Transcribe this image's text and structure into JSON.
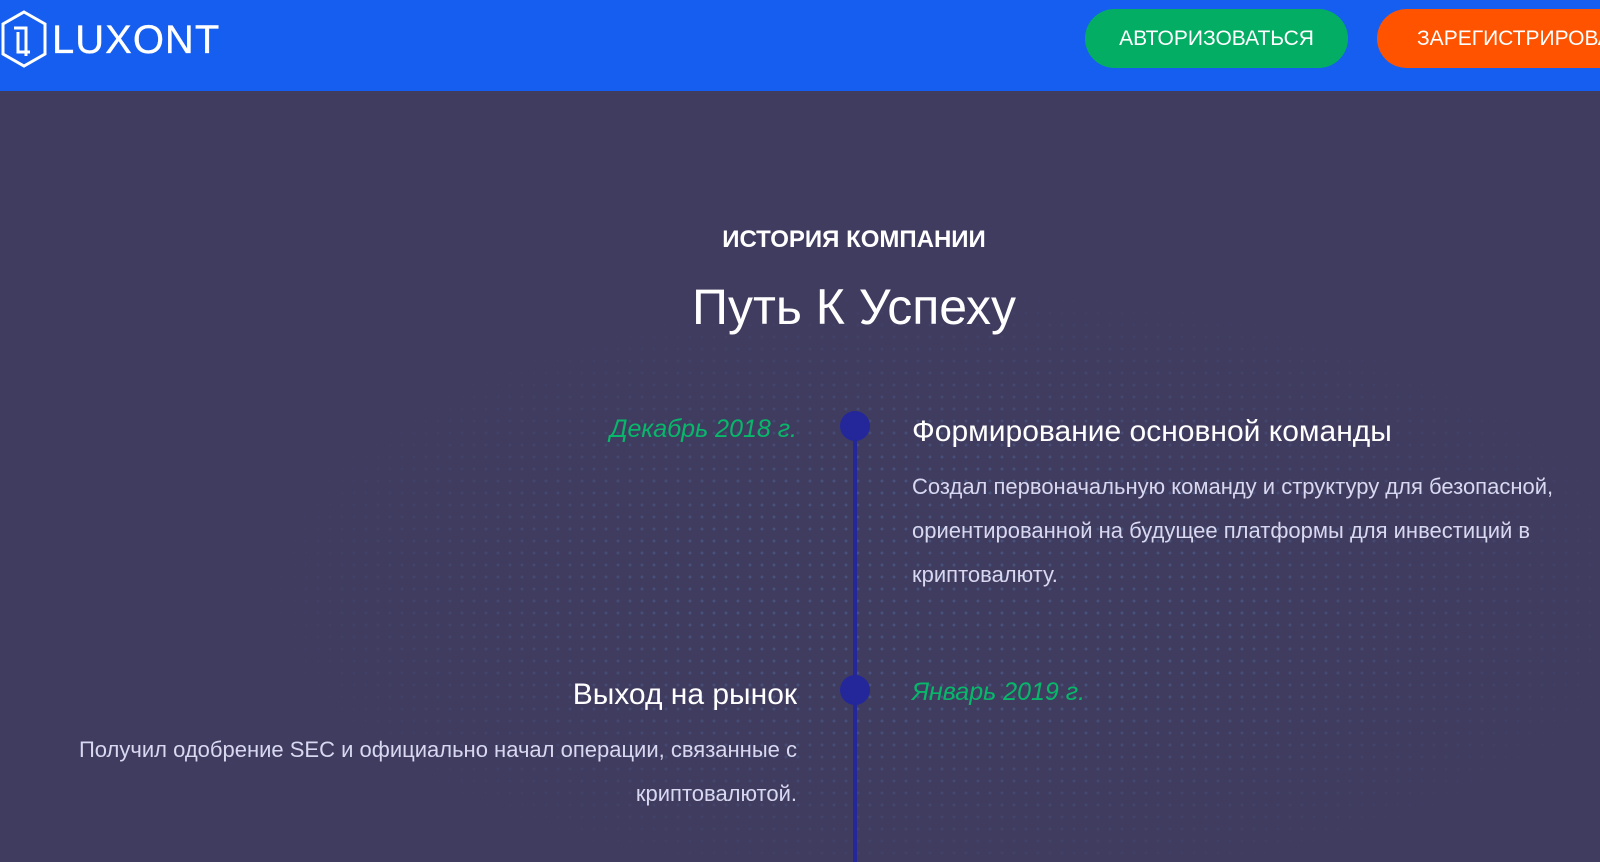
{
  "header": {
    "logo": "LUXONT",
    "login_label": "АВТОРИЗОВАТЬСЯ",
    "register_label": "ЗАРЕГИСТРИРОВАТЬСЯ"
  },
  "section": {
    "kicker": "ИСТОРИЯ КОМПАНИИ",
    "title": "Путь К Успеху"
  },
  "timeline": [
    {
      "date": "Декабрь 2018 г.",
      "title": "Формирование основной команды",
      "text": "Создал первоначальную команду и структуру для безопасной, ориентированной на будущее платформы для инвестиций в криптовалюту."
    },
    {
      "date": "Январь 2019 г.",
      "title": "Выход на рынок",
      "text": "Получил одобрение SEC и официально начал операции, связанные с криптовалютой."
    }
  ]
}
